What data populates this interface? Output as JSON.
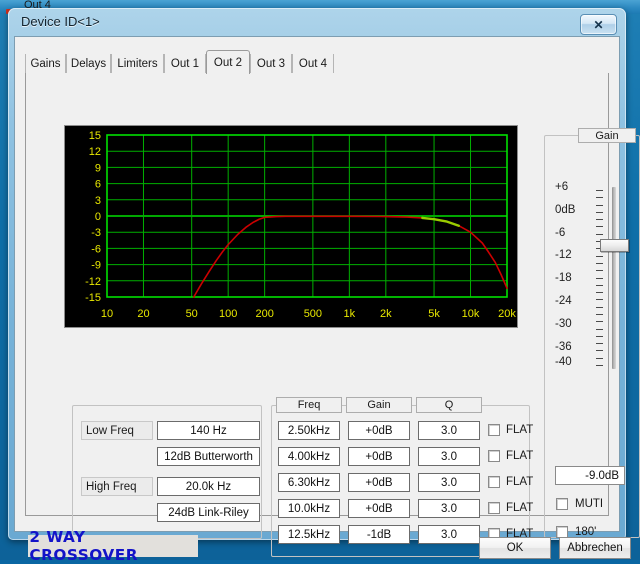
{
  "background_window": {
    "title": "Out 4"
  },
  "dialog": {
    "title": "Device ID<1>",
    "close_label": "✕"
  },
  "tabs": [
    {
      "label": "Gains",
      "active": false
    },
    {
      "label": "Delays",
      "active": false
    },
    {
      "label": "Limiters",
      "active": false
    },
    {
      "label": "Out 1",
      "active": false
    },
    {
      "label": "Out 2",
      "active": true
    },
    {
      "label": "Out 3",
      "active": false
    },
    {
      "label": "Out 4",
      "active": false
    }
  ],
  "chart_data": {
    "type": "line",
    "title": "",
    "xlabel": "",
    "ylabel": "",
    "x_tick_labels": [
      "10",
      "20",
      "50",
      "100",
      "200",
      "500",
      "1k",
      "2k",
      "5k",
      "10k",
      "20k"
    ],
    "x_tick_values": [
      10,
      20,
      50,
      100,
      200,
      500,
      1000,
      2000,
      5000,
      10000,
      20000
    ],
    "y_tick_labels": [
      "15",
      "12",
      "9",
      "6",
      "3",
      "0",
      "-3",
      "-6",
      "-9",
      "-12",
      "-15"
    ],
    "y_tick_values": [
      15,
      12,
      9,
      6,
      3,
      0,
      -3,
      -6,
      -9,
      -12,
      -15
    ],
    "ylim": [
      -15,
      15
    ],
    "xlim": [
      10,
      20000
    ],
    "xscale": "log",
    "grid": true,
    "background_color": "#000000",
    "grid_color": "#00b000",
    "axis_color": "#00e000",
    "tick_label_color": "#e8e800",
    "series": [
      {
        "name": "response",
        "color": "#cc0000",
        "points": [
          [
            52,
            -15.0
          ],
          [
            60,
            -12.6
          ],
          [
            70,
            -10.2
          ],
          [
            80,
            -8.2
          ],
          [
            90,
            -6.6
          ],
          [
            100,
            -5.3
          ],
          [
            120,
            -3.4
          ],
          [
            140,
            -2.1
          ],
          [
            160,
            -1.2
          ],
          [
            180,
            -0.6
          ],
          [
            200,
            -0.25
          ],
          [
            250,
            -0.1
          ],
          [
            300,
            -0.05
          ],
          [
            500,
            -0.05
          ],
          [
            800,
            -0.05
          ],
          [
            1000,
            -0.05
          ],
          [
            2000,
            -0.1
          ],
          [
            3000,
            -0.2
          ],
          [
            4000,
            -0.35
          ],
          [
            5000,
            -0.6
          ],
          [
            6300,
            -1.0
          ],
          [
            8000,
            -1.8
          ],
          [
            10000,
            -3.0
          ],
          [
            12500,
            -5.0
          ],
          [
            14000,
            -6.6
          ],
          [
            16000,
            -8.6
          ],
          [
            18000,
            -11.0
          ],
          [
            20000,
            -13.4
          ]
        ]
      },
      {
        "name": "reference",
        "color": "#99cc00",
        "points": [
          [
            4000,
            -0.35
          ],
          [
            5000,
            -0.6
          ],
          [
            6300,
            -1.0
          ],
          [
            8000,
            -1.8
          ]
        ]
      }
    ]
  },
  "gain_panel": {
    "legend": "Gain",
    "scale_labels": [
      "+6",
      "0dB",
      "-6",
      "-12",
      "-18",
      "-24",
      "-30",
      "-36",
      "-40"
    ],
    "scale_values": [
      6,
      0,
      -6,
      -12,
      -18,
      -24,
      -30,
      -36,
      -40
    ],
    "value": "-9.0dB",
    "slider_value": -9.0,
    "checkboxes": [
      {
        "label": "MUTI",
        "checked": false
      },
      {
        "label": "180'",
        "checked": false
      }
    ]
  },
  "crossover": {
    "rows": [
      {
        "label": "Low Freq",
        "freq": "140 Hz",
        "filter": "12dB Butterworth"
      },
      {
        "label": "High Freq",
        "freq": "20.0k Hz",
        "filter": "24dB Link-Riley"
      }
    ]
  },
  "eq": {
    "headers": [
      "Freq",
      "Gain",
      "Q"
    ],
    "flat_label": "FLAT",
    "rows": [
      {
        "freq": "2.50kHz",
        "gain": "+0dB",
        "q": "3.0",
        "flat": false
      },
      {
        "freq": "4.00kHz",
        "gain": "+0dB",
        "q": "3.0",
        "flat": false
      },
      {
        "freq": "6.30kHz",
        "gain": "+0dB",
        "q": "3.0",
        "flat": false
      },
      {
        "freq": "10.0kHz",
        "gain": "+0dB",
        "q": "3.0",
        "flat": false
      },
      {
        "freq": "12.5kHz",
        "gain": "-1dB",
        "q": "3.0",
        "flat": false
      }
    ]
  },
  "footer": {
    "brand": "2 WAY CROSSOVER",
    "ok_label": "OK",
    "cancel_label": "Abbrechen"
  }
}
